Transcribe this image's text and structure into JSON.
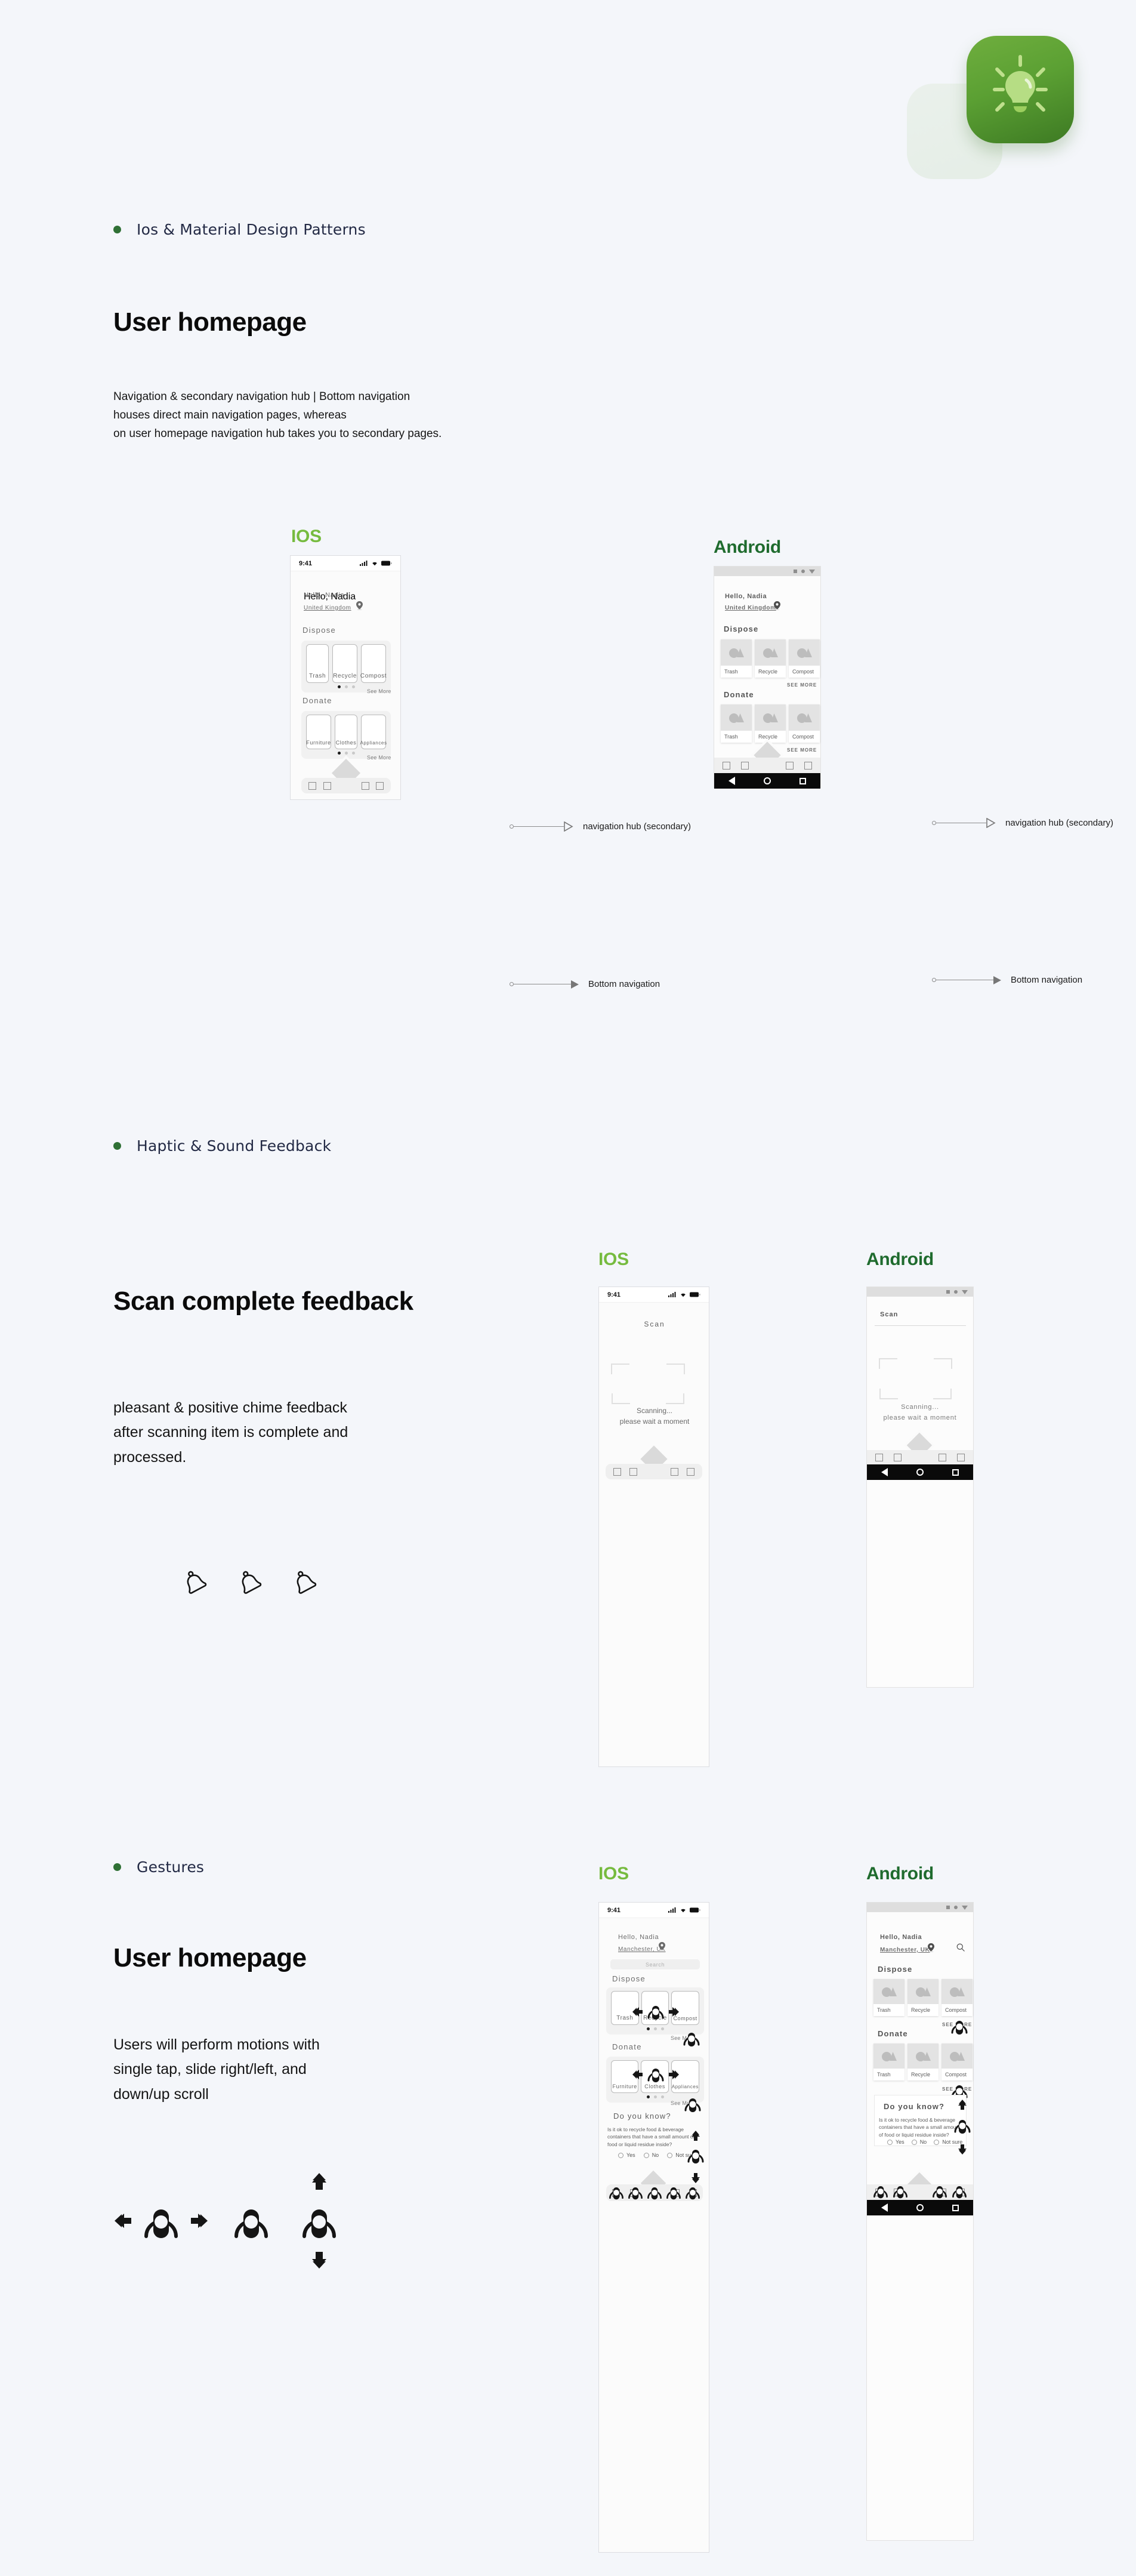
{
  "brand": {
    "logo_icon": "lightbulb-icon",
    "accent_green": "#5ba033",
    "ios_label_color": "#76bb3f",
    "android_label_color": "#1f6b2e"
  },
  "sections": [
    {
      "id": "nav",
      "bullet": "Ios & Material Design Patterns",
      "title": "User homepage",
      "body": "Navigation & secondary navigation hub | Bottom navigation\nhouses direct main navigation pages, whereas\non user homepage navigation hub takes you to secondary pages.",
      "ios_label": "IOS",
      "android_label": "Android",
      "annotations": [
        {
          "label": "navigation hub (secondary)"
        },
        {
          "label": "Bottom navigation"
        },
        {
          "label": "navigation hub (secondary)"
        },
        {
          "label": "Bottom navigation"
        }
      ]
    },
    {
      "id": "haptic",
      "bullet": "Haptic & Sound Feedback",
      "title": "Scan complete feedback",
      "body": "pleasant & positive chime feedback\nafter scanning item is complete and\nprocessed.",
      "ios_label": "IOS",
      "android_label": "Android",
      "icons": [
        "bell-icon",
        "bell-icon",
        "bell-icon"
      ]
    },
    {
      "id": "gestures",
      "bullet": "Gestures",
      "title": "User homepage",
      "body": "Users will perform motions with\nsingle tap, slide right/left, and\ndown/up scroll",
      "ios_label": "IOS",
      "android_label": "Android",
      "icons": [
        "swipe-horizontal-icon",
        "tap-icon",
        "scroll-vertical-icon"
      ]
    }
  ],
  "phone_home": {
    "status_time": "9:41",
    "greeting": "Hello, Nadia",
    "location": "United Kingdom",
    "location_icon": "map-pin-icon",
    "dispose_heading": "Dispose",
    "donate_heading": "Donate",
    "see_more_ios": "See More",
    "see_more_android": "SEE MORE",
    "dispose_cards": [
      "Trash",
      "Recycle",
      "Compost"
    ],
    "donate_cards_ios": [
      "Furniture",
      "Clothes",
      "Appliances"
    ],
    "donate_cards_android": [
      "Trash",
      "Recycle",
      "Compost"
    ],
    "carousel_dots": 3,
    "carousel_active": 0,
    "tab_count": 4,
    "fab_icon": "diamond-fab-icon",
    "android_nav": [
      "back-icon",
      "home-icon",
      "recents-icon"
    ],
    "placeholder_icon": "image-placeholder-icon"
  },
  "phone_scan": {
    "status_time": "9:41",
    "title": "Scan",
    "status_line1": "Scanning...",
    "status_line2": "please wait a moment",
    "scan_frame_icon": "scan-brackets-icon",
    "tab_count": 4,
    "fab_icon": "diamond-fab-icon"
  },
  "phone_gestures": {
    "status_time": "9:41",
    "greeting": "Hello, Nadia",
    "location": "Manchester, UK",
    "location_icon": "map-pin-icon",
    "search_placeholder": "Search",
    "search_icon": "search-icon",
    "dispose_heading": "Dispose",
    "donate_heading": "Donate",
    "see_more_ios": "See More",
    "see_more_android": "SEE MORE",
    "dispose_cards": [
      "Trash",
      "Recycle",
      "Compost"
    ],
    "donate_cards_ios": [
      "Furniture",
      "Clothes",
      "Appliances"
    ],
    "donate_cards_android": [
      "Trash",
      "Recycle",
      "Compost"
    ],
    "quiz_title": "Do you know?",
    "quiz_question": "Is it ok to recycle food & beverage containers that have a small amount of food or liquid residue inside?",
    "quiz_options": [
      "Yes",
      "No",
      "Not sure"
    ],
    "tab_count": 4,
    "fab_icon": "diamond-fab-icon"
  }
}
